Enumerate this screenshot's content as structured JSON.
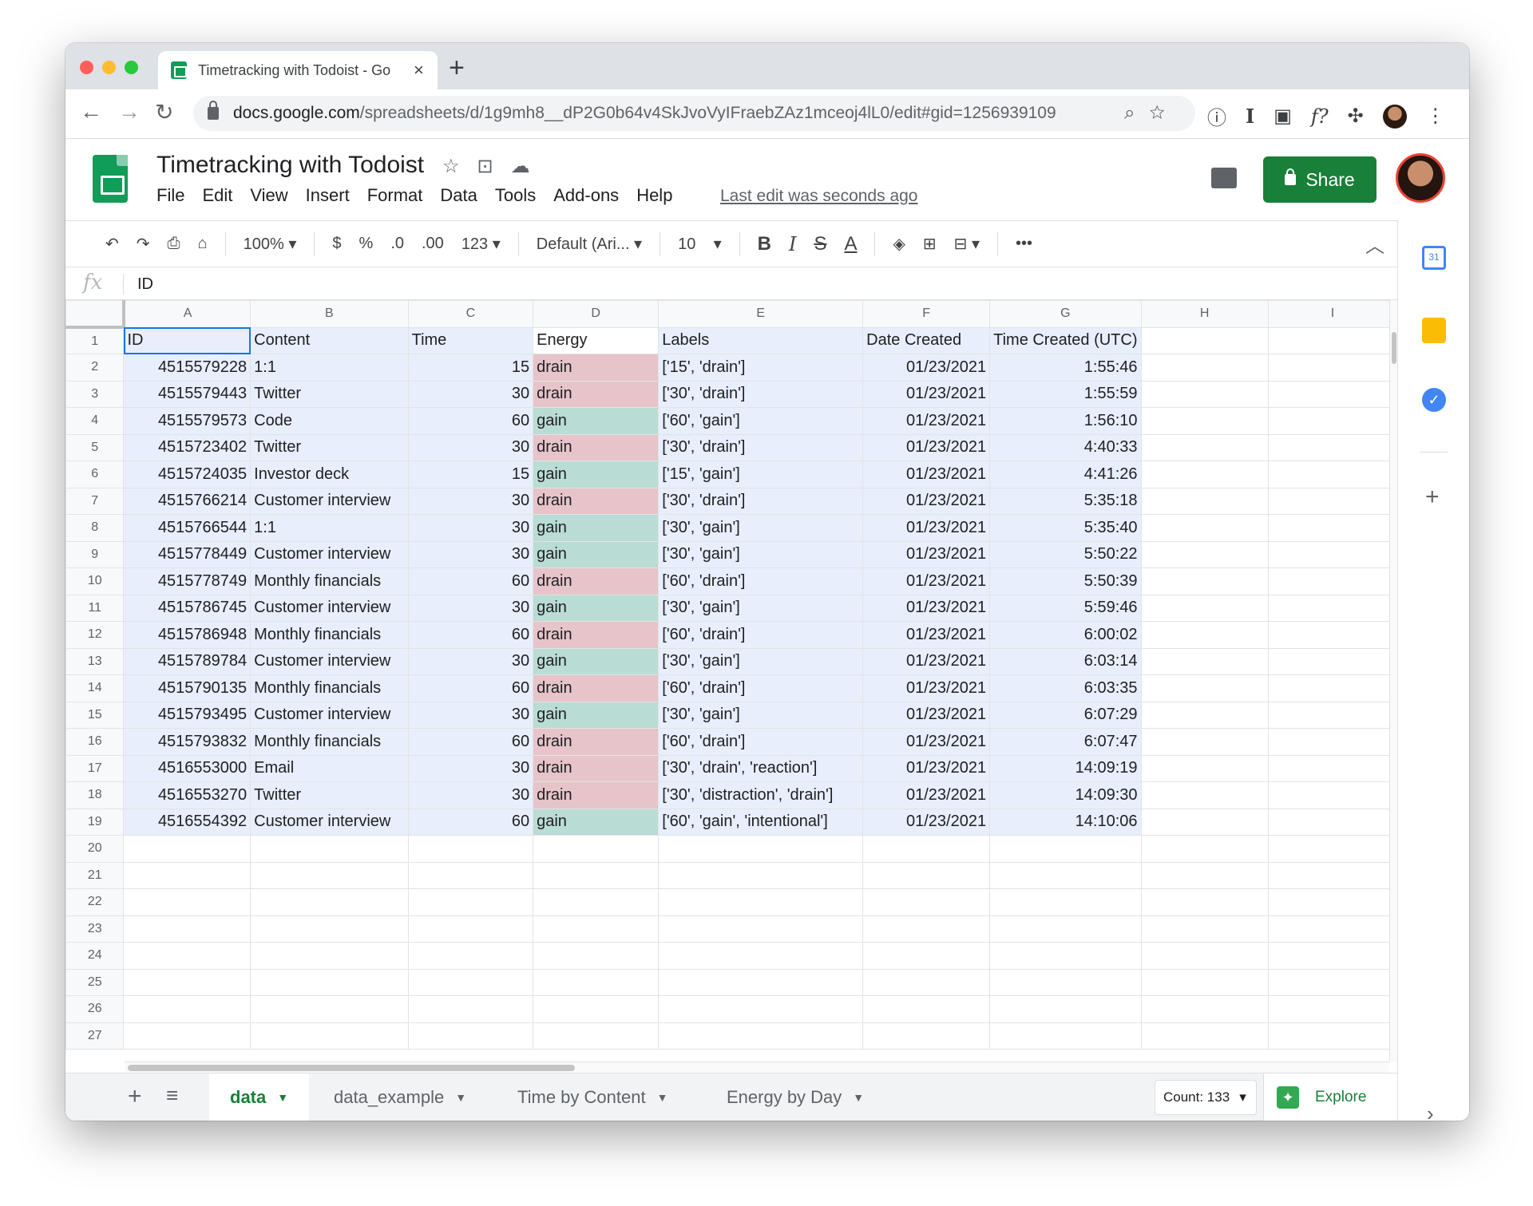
{
  "browser": {
    "tab_title": "Timetracking with Todoist - Go",
    "url_domain": "docs.google.com",
    "url_path": "/spreadsheets/d/1g9mh8__dP2G0b64v4SkJvoVyIFraebZAz1mceoj4lL0/edit#gid=1256939109"
  },
  "doc": {
    "title": "Timetracking with Todoist",
    "last_edit": "Last edit was seconds ago",
    "share_label": "Share"
  },
  "menu": [
    "File",
    "Edit",
    "View",
    "Insert",
    "Format",
    "Data",
    "Tools",
    "Add-ons",
    "Help"
  ],
  "toolbar": {
    "zoom": "100%",
    "currency": "$",
    "percent": "%",
    "dec_decrease": ".0",
    "dec_increase": ".00",
    "more_formats": "123",
    "font": "Default (Ari...",
    "font_size": "10",
    "bold": "B",
    "italic": "I",
    "strike": "S",
    "text_color": "A",
    "more": "•••"
  },
  "formula_bar": {
    "fx": "fx",
    "value": "ID"
  },
  "columns": [
    "A",
    "B",
    "C",
    "D",
    "E",
    "F",
    "G",
    "H",
    "I"
  ],
  "headers": [
    "ID",
    "Content",
    "Time",
    "Energy",
    "Labels",
    "Date Created",
    "Time Created (UTC)"
  ],
  "rows": [
    [
      "4515579228",
      "1:1",
      "15",
      "drain",
      "['15', 'drain']",
      "01/23/2021",
      "1:55:46"
    ],
    [
      "4515579443",
      "Twitter",
      "30",
      "drain",
      "['30', 'drain']",
      "01/23/2021",
      "1:55:59"
    ],
    [
      "4515579573",
      "Code",
      "60",
      "gain",
      "['60', 'gain']",
      "01/23/2021",
      "1:56:10"
    ],
    [
      "4515723402",
      "Twitter",
      "30",
      "drain",
      "['30', 'drain']",
      "01/23/2021",
      "4:40:33"
    ],
    [
      "4515724035",
      "Investor deck",
      "15",
      "gain",
      "['15', 'gain']",
      "01/23/2021",
      "4:41:26"
    ],
    [
      "4515766214",
      "Customer interview",
      "30",
      "drain",
      "['30', 'drain']",
      "01/23/2021",
      "5:35:18"
    ],
    [
      "4515766544",
      "1:1",
      "30",
      "gain",
      "['30', 'gain']",
      "01/23/2021",
      "5:35:40"
    ],
    [
      "4515778449",
      "Customer interview",
      "30",
      "gain",
      "['30', 'gain']",
      "01/23/2021",
      "5:50:22"
    ],
    [
      "4515778749",
      "Monthly financials",
      "60",
      "drain",
      "['60', 'drain']",
      "01/23/2021",
      "5:50:39"
    ],
    [
      "4515786745",
      "Customer interview",
      "30",
      "gain",
      "['30', 'gain']",
      "01/23/2021",
      "5:59:46"
    ],
    [
      "4515786948",
      "Monthly financials",
      "60",
      "drain",
      "['60', 'drain']",
      "01/23/2021",
      "6:00:02"
    ],
    [
      "4515789784",
      "Customer interview",
      "30",
      "gain",
      "['30', 'gain']",
      "01/23/2021",
      "6:03:14"
    ],
    [
      "4515790135",
      "Monthly financials",
      "60",
      "drain",
      "['60', 'drain']",
      "01/23/2021",
      "6:03:35"
    ],
    [
      "4515793495",
      "Customer interview",
      "30",
      "gain",
      "['30', 'gain']",
      "01/23/2021",
      "6:07:29"
    ],
    [
      "4515793832",
      "Monthly financials",
      "60",
      "drain",
      "['60', 'drain']",
      "01/23/2021",
      "6:07:47"
    ],
    [
      "4516553000",
      "Email",
      "30",
      "drain",
      "['30', 'drain', 'reaction']",
      "01/23/2021",
      "14:09:19"
    ],
    [
      "4516553270",
      "Twitter",
      "30",
      "drain",
      "['30', 'distraction', 'drain']",
      "01/23/2021",
      "14:09:30"
    ],
    [
      "4516554392",
      "Customer interview",
      "60",
      "gain",
      "['60', 'gain', 'intentional']",
      "01/23/2021",
      "14:10:06"
    ]
  ],
  "empty_rows": [
    20,
    21,
    22,
    23,
    24,
    25,
    26,
    27
  ],
  "energy_colors": {
    "drain": "#e6c4ca",
    "gain": "#b9dcd4"
  },
  "sheet_tabs": [
    "data",
    "data_example",
    "Time by Content",
    "Energy by Day"
  ],
  "active_sheet": "data",
  "status": {
    "count": "Count: 133",
    "explore": "Explore"
  },
  "side_panel": {
    "calendar_day": "31"
  }
}
